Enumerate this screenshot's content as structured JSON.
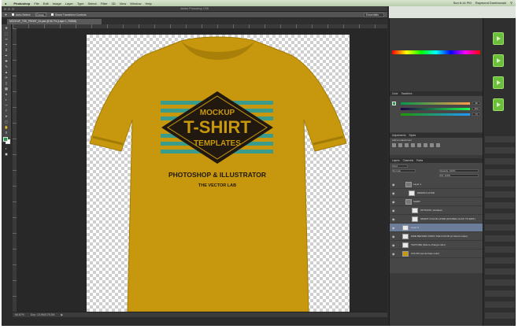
{
  "menubar": {
    "app": "Photoshop",
    "items": [
      "File",
      "Edit",
      "Image",
      "Layer",
      "Type",
      "Select",
      "Filter",
      "3D",
      "View",
      "Window",
      "Help"
    ],
    "clock": "Sun 6:14 PM",
    "user": "Raymond Dombrovski"
  },
  "window": {
    "title": "Adobe Photoshop CS6"
  },
  "options_bar": {
    "auto_select": "Auto-Select:",
    "auto_select_value": "Group",
    "show_transform": "Show Transform Controls",
    "workspace": "Essentials"
  },
  "document": {
    "tab": "MOCKUP_TEE_FRONT_04.psd @ 66.7% (Layer 1, RGB/8)",
    "zoom": "66.67%",
    "doc_size": "Doc: 13.9M/175.3M"
  },
  "artwork": {
    "shirt_color": "#c7980d",
    "diamond_line1": "MOCKUP",
    "diamond_line2": "T-SHIRT",
    "diamond_line3": "TEMPLATES",
    "tagline": "PHOTOSHOP & ILLUSTRATOR",
    "subtagline": "THE VECTOR LAB",
    "stripe_color": "#3b9c8c",
    "diamond_color": "#211810"
  },
  "panels": {
    "color_tabs": [
      "Color",
      "Swatches"
    ],
    "rgb_values": [
      "30",
      "154",
      "74"
    ],
    "adjust_tabs": [
      "Adjustments",
      "Styles"
    ],
    "adjust_label": "Add an adjustment",
    "layers_tabs": [
      "Layers",
      "Channels",
      "Paths"
    ],
    "kind": "Kind",
    "blend": "Normal",
    "opacity": "Opacity: 100%",
    "fill": "Fill: 100%",
    "layers": [
      {
        "name": "Layer 1"
      },
      {
        "name": "DESIGN LAYER"
      },
      {
        "name": "SHIRT"
      },
      {
        "name": "OPTIONS / shadows"
      },
      {
        "name": "SMART COLOR LAYER (DOUBLE CLICK TO EDIT)"
      },
      {
        "name": "Layer 0"
      },
      {
        "name": "HIDE BEFORE USING THE COLOR (or blend modes)"
      },
      {
        "name": "TEXTURE (hide to change color)"
      },
      {
        "name": "COLOR (set as base color)"
      }
    ]
  },
  "colors": {
    "accent": "#6bbf3a",
    "selection": "#6b7d99"
  }
}
